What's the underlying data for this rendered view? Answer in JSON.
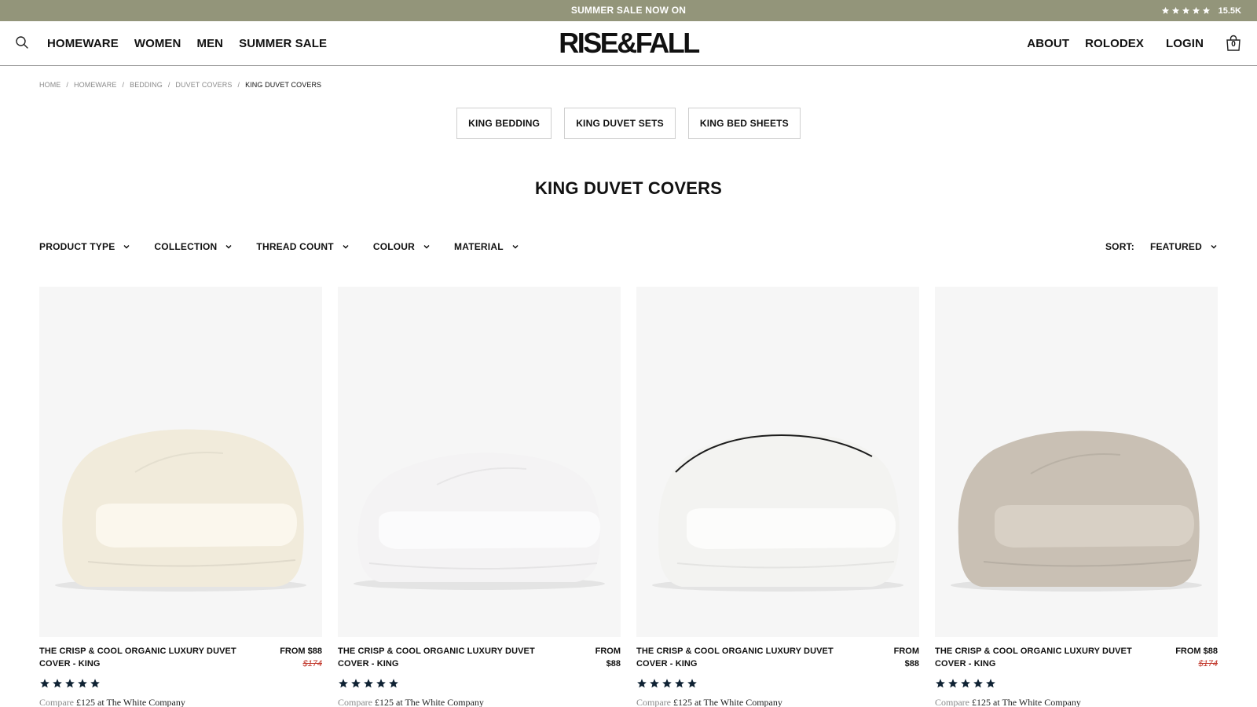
{
  "announcement": {
    "text": "SUMMER SALE NOW ON",
    "rating_count": "15.5K",
    "stars": 5
  },
  "header": {
    "logo": "RISE&FALL",
    "nav_left": [
      "HOMEWARE",
      "WOMEN",
      "MEN",
      "SUMMER SALE"
    ],
    "nav_right": [
      "ABOUT",
      "ROLODEX",
      "LOGIN"
    ],
    "cart_count": "0",
    "icons": {
      "search": "search-icon",
      "cart": "shopping-bag-icon"
    }
  },
  "breadcrumb": [
    "HOME",
    "HOMEWARE",
    "BEDDING",
    "DUVET COVERS",
    "KING DUVET COVERS"
  ],
  "quick_links": [
    "KING BEDDING",
    "KING DUVET SETS",
    "KING BED SHEETS"
  ],
  "page_title": "KING DUVET COVERS",
  "filters": [
    "PRODUCT TYPE",
    "COLLECTION",
    "THREAD COUNT",
    "COLOUR",
    "MATERIAL"
  ],
  "sort": {
    "label": "SORT:",
    "value": "FEATURED"
  },
  "products": [
    {
      "title": "THE CRISP & COOL ORGANIC LUXURY DUVET COVER - KING",
      "price": "FROM $88",
      "old_price": "$174",
      "rating": 5,
      "compare_word": "Compare",
      "compare_text": "£125 at The White Company",
      "color": "#f1ebdb"
    },
    {
      "title": "THE CRISP & COOL ORGANIC LUXURY DUVET COVER - KING",
      "price": "FROM $88",
      "old_price": "",
      "rating": 5,
      "compare_word": "Compare",
      "compare_text": "£125 at The White Company",
      "color": "#f4f3f4"
    },
    {
      "title": "THE CRISP & COOL ORGANIC LUXURY DUVET COVER - KING",
      "price": "FROM $88",
      "old_price": "",
      "rating": 5,
      "compare_word": "Compare",
      "compare_text": "£125 at The White Company",
      "color": "#f3f3f1"
    },
    {
      "title": "THE CRISP & COOL ORGANIC LUXURY DUVET COVER - KING",
      "price": "FROM $88",
      "old_price": "$174",
      "rating": 5,
      "compare_word": "Compare",
      "compare_text": "£125 at The White Company",
      "color": "#c9c0b4"
    }
  ],
  "colors": {
    "announcement_bg": "#93957a",
    "sale_red": "#c23a2e",
    "star_color": "#0f2233"
  }
}
